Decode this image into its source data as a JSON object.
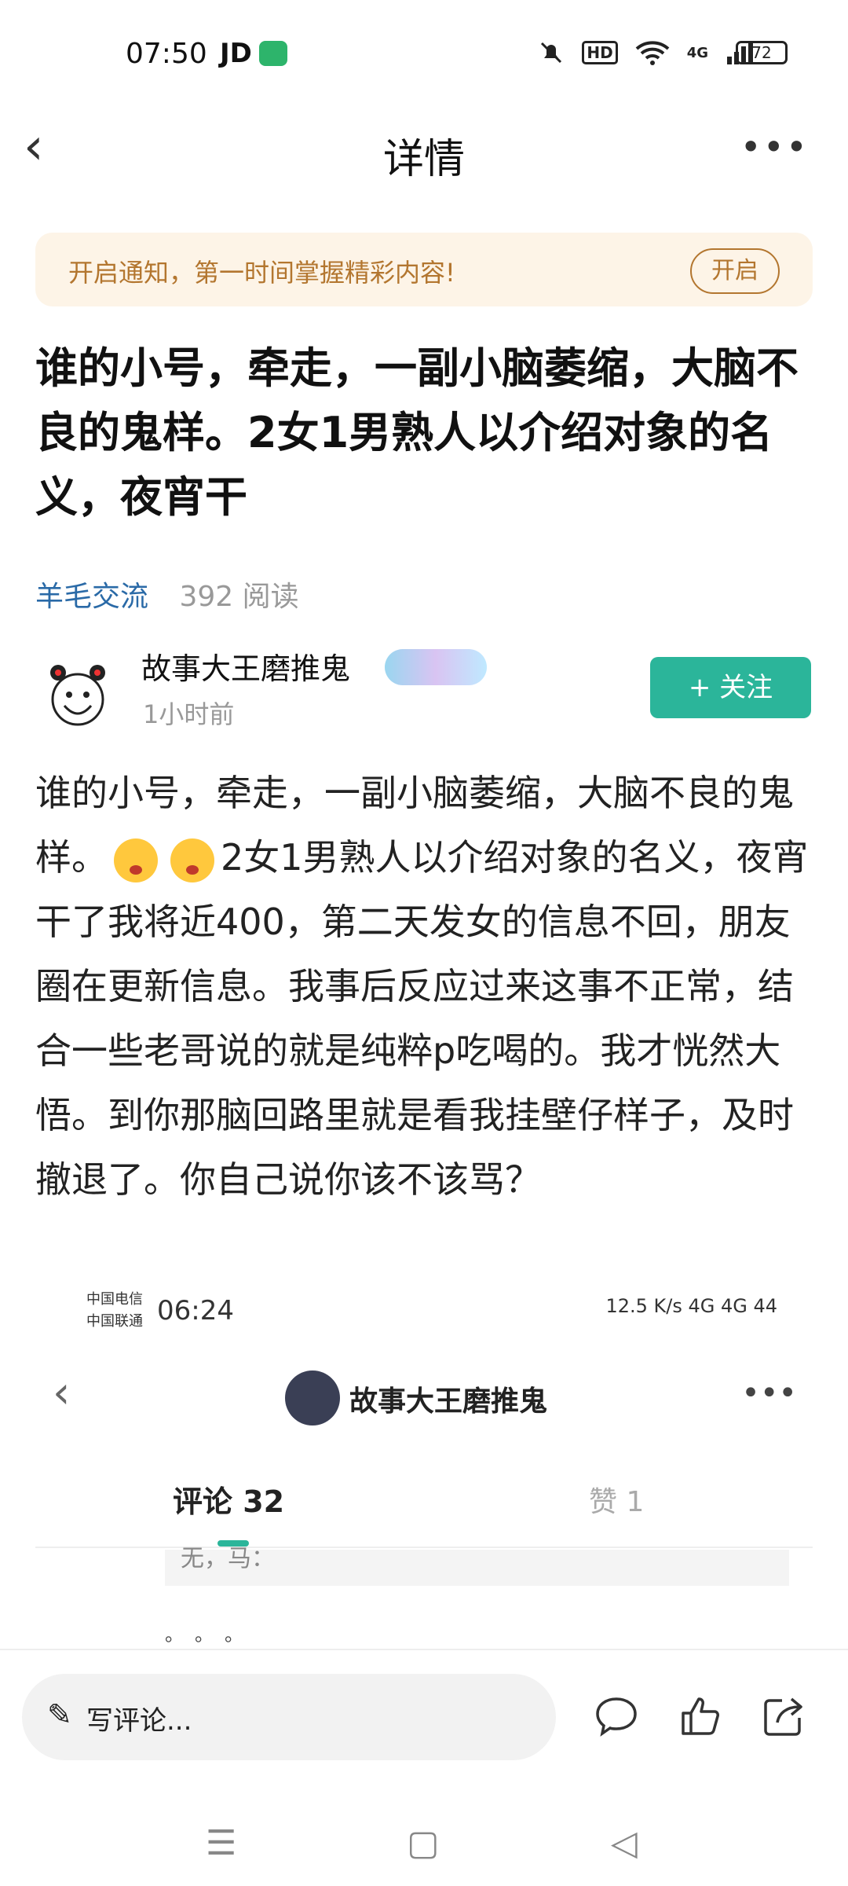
{
  "status_bar": {
    "time": "07:50",
    "app": "JD",
    "hd": "HD",
    "network": "4G",
    "battery": "72"
  },
  "nav": {
    "title": "详情"
  },
  "notice": {
    "text": "开启通知，第一时间掌握精彩内容!",
    "button": "开启"
  },
  "post": {
    "headline": "谁的小号，牵走，一副小脑萎缩，大脑不良的鬼样。2女1男熟人以介绍对象的名义，夜宵干",
    "category": "羊毛交流",
    "reads": "392 阅读",
    "author": "故事大王磨推鬼",
    "time_ago": "1小时前",
    "follow_label": "+ 关注",
    "body_part1": "谁的小号，牵走，一副小脑萎缩，大脑不良的鬼样。",
    "body_part2": "2女1男熟人以介绍对象的名义，夜宵干了我将近400，第二天发女的信息不回，朋友圈在更新信息。我事后反应过来这事不正常，结合一些老哥说的就是纯粹p吃喝的。我才恍然大悟。到你那脑回路里就是看我挂壁仔样子，及时撤退了。你自己说你该不该骂？"
  },
  "embedded": {
    "carrier1": "中国电信",
    "carrier2": "中国联通",
    "time": "06:24",
    "status_right": "12.5 K/s  4G  4G  44",
    "profile_name": "故事大王磨推鬼",
    "tab_comments": "评论 32",
    "tab_likes": "赞 1",
    "partial_text": "无，马：",
    "dots": "。。。"
  },
  "comment_bar": {
    "placeholder": "写评论..."
  },
  "icons": [
    "back-icon",
    "more-icon",
    "comment-icon",
    "like-icon",
    "share-icon",
    "menu-icon",
    "home-icon",
    "back-triangle-icon"
  ]
}
